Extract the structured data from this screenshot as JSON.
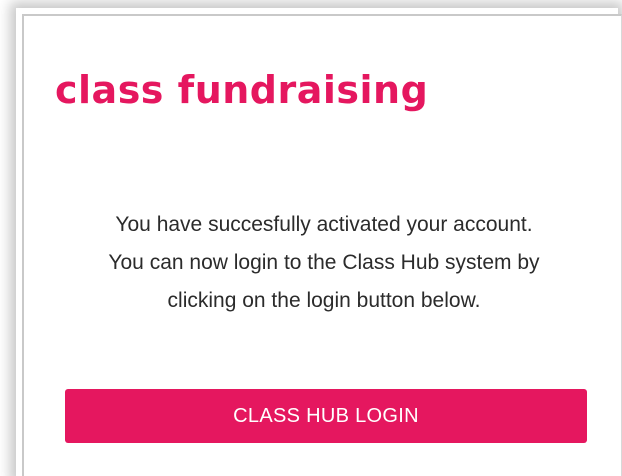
{
  "brand": {
    "logo_text": "class fundraising",
    "accent_color": "#e5175f"
  },
  "message": {
    "lines": [
      "You have succesfully activated your account.",
      "You can now login to the Class Hub system by",
      "clicking on the login button below."
    ]
  },
  "actions": {
    "login_label": "CLASS HUB LOGIN"
  }
}
